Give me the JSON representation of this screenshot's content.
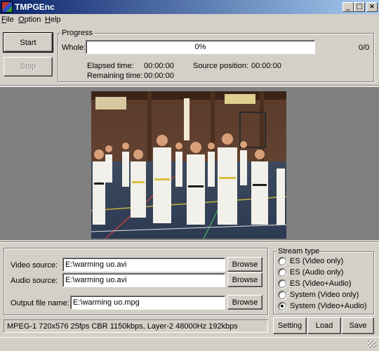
{
  "window": {
    "title": "TMPGEnc",
    "minimize": "_",
    "maximize": "□",
    "close": "×"
  },
  "menu": [
    "File",
    "Option",
    "Help"
  ],
  "menu_underline": [
    "F",
    "O",
    "H"
  ],
  "controls": {
    "start_label": "Start",
    "stop_label": "Stop"
  },
  "progress": {
    "group_label": "Progress",
    "whole_label": "Whole:",
    "whole_value": "0%",
    "whole_fraction": 0,
    "count": "0/0",
    "elapsed_label": "Elapsed time:",
    "elapsed_value": "00:00:00",
    "remaining_label": "Remaining time:",
    "remaining_value": "00:00:00",
    "source_position_label": "Source position:",
    "source_position_value": "00:00:00"
  },
  "preview": {
    "image": "video-frame-martial-arts-class"
  },
  "sources": {
    "video_label": "Video source:",
    "video_value": "E:\\warming uo.avi",
    "audio_label": "Audio source:",
    "audio_value": "E:\\warming uo.avi",
    "output_label": "Output file name:",
    "output_value": "E:\\warming uo.mpg",
    "browse_label": "Browse"
  },
  "stream_type": {
    "group_label": "Stream type",
    "options": [
      {
        "label": "ES (Video only)",
        "checked": false
      },
      {
        "label": "ES (Audio only)",
        "checked": false
      },
      {
        "label": "ES (Video+Audio)",
        "checked": false
      },
      {
        "label": "System (Video only)",
        "checked": false
      },
      {
        "label": "System (Video+Audio)",
        "checked": true
      }
    ]
  },
  "status": {
    "text": "MPEG-1 720x576 25fps CBR 1150kbps,  Layer-2 48000Hz 192kbps"
  },
  "bottom_buttons": {
    "setting_label": "Setting",
    "load_label": "Load",
    "save_label": "Save"
  },
  "colors": {
    "titlebar_start": "#0a246a",
    "titlebar_end": "#a6caf0",
    "face": "#d4d0c8",
    "preview_bg": "#808080"
  }
}
